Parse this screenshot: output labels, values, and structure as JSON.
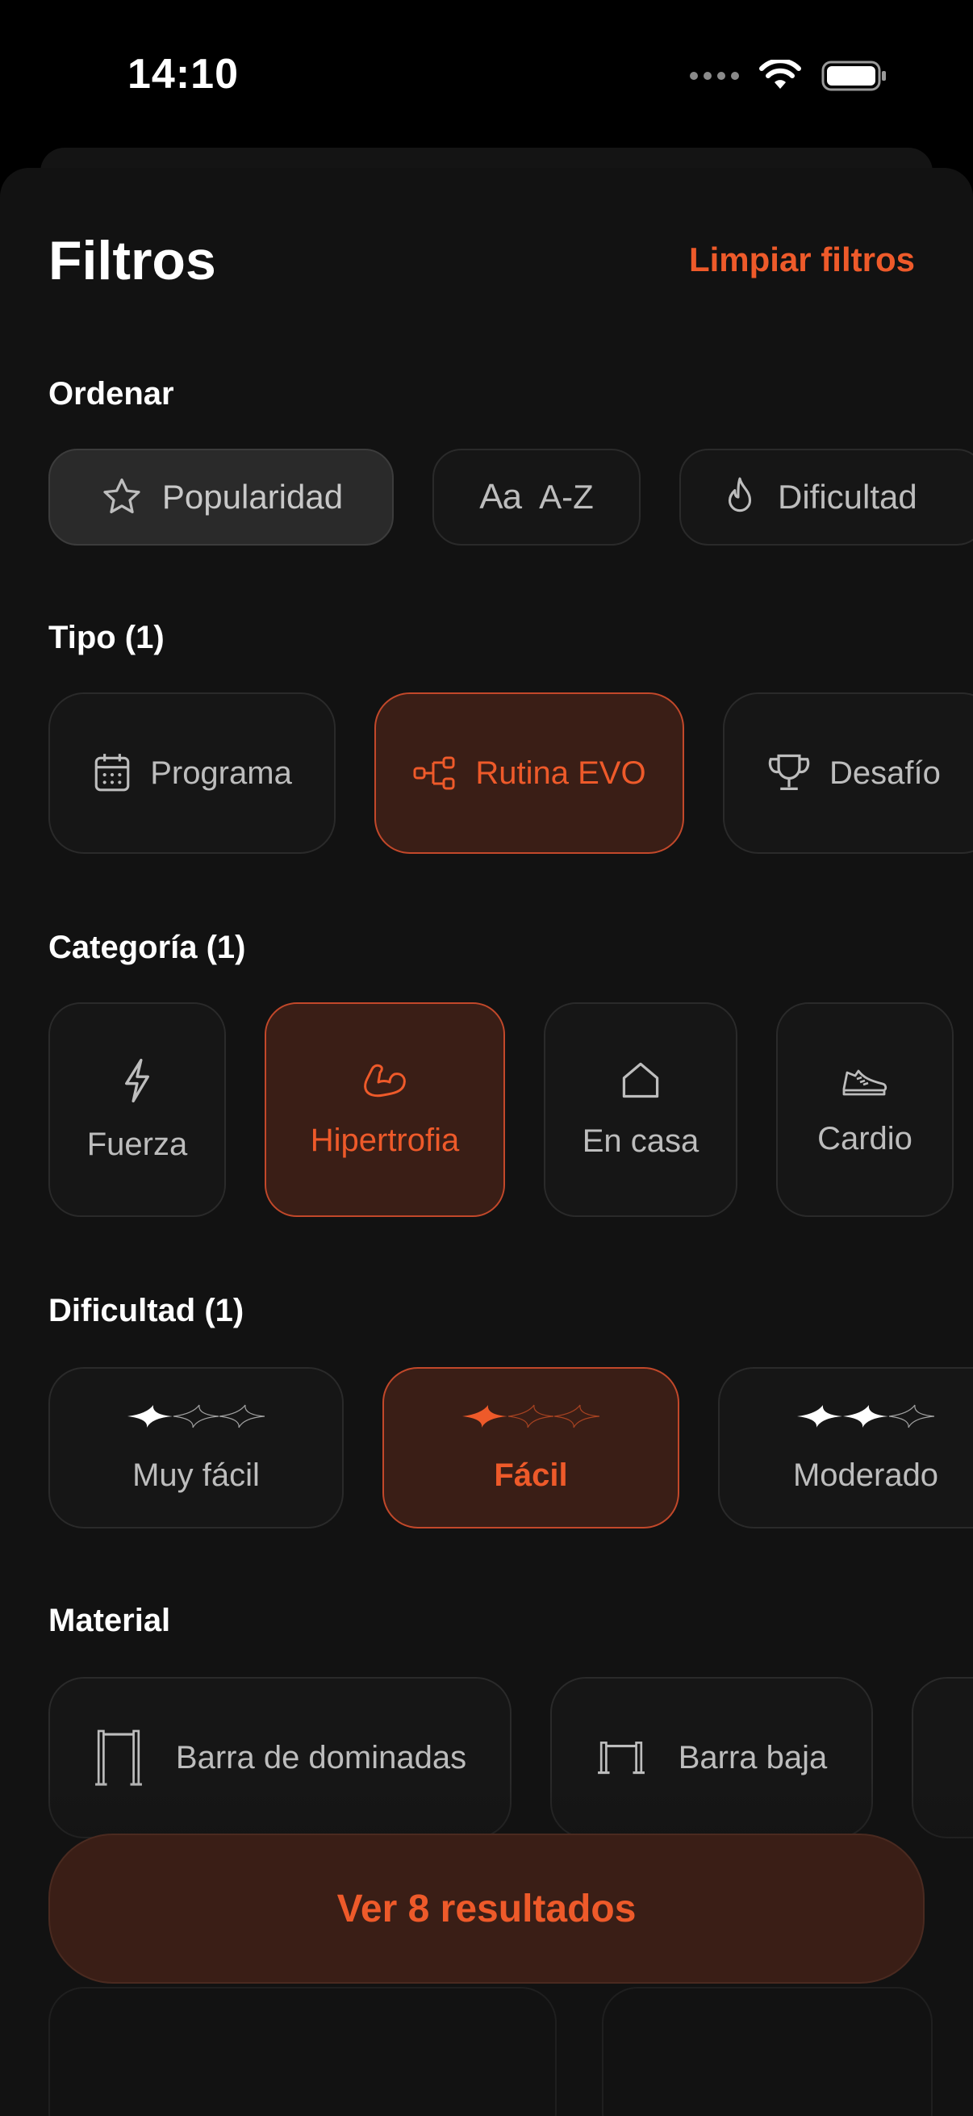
{
  "status": {
    "time": "14:10"
  },
  "header": {
    "title": "Filtros",
    "clear_label": "Limpiar filtros"
  },
  "sort": {
    "label": "Ordenar",
    "options": [
      {
        "label": "Popularidad",
        "icon": "star-icon",
        "selected": true
      },
      {
        "label": "A-Z",
        "icon": "font-aa-icon",
        "selected": false
      },
      {
        "label": "Dificultad",
        "icon": "flame-icon",
        "selected": false
      }
    ]
  },
  "type": {
    "label": "Tipo (1)",
    "options": [
      {
        "label": "Programa",
        "icon": "calendar-icon",
        "selected": false
      },
      {
        "label": "Rutina EVO",
        "icon": "flow-icon",
        "selected": true
      },
      {
        "label": "Desafío",
        "icon": "trophy-icon",
        "selected": false
      }
    ]
  },
  "category": {
    "label": "Categoría (1)",
    "options": [
      {
        "label": "Fuerza",
        "icon": "bolt-icon",
        "selected": false
      },
      {
        "label": "Hipertrofia",
        "icon": "flexed-arm-icon",
        "selected": true
      },
      {
        "label": "En casa",
        "icon": "house-icon",
        "selected": false
      },
      {
        "label": "Cardio",
        "icon": "sneaker-icon",
        "selected": false
      }
    ]
  },
  "difficulty": {
    "label": "Dificultad (1)",
    "options": [
      {
        "label": "Muy fácil",
        "level": 1,
        "max": 3,
        "selected": false
      },
      {
        "label": "Fácil",
        "level": 1,
        "max": 3,
        "selected": true
      },
      {
        "label": "Moderado",
        "level": 2,
        "max": 3,
        "selected": false
      }
    ]
  },
  "material": {
    "label": "Material",
    "options": [
      {
        "label": "Barra de dominadas",
        "icon": "pullup-bar-icon"
      },
      {
        "label": "Barra baja",
        "icon": "low-bar-icon"
      }
    ]
  },
  "cta": {
    "label": "Ver 8 resultados"
  },
  "colors": {
    "accent": "#ee5a2a",
    "accent_bg": "#3a1e16",
    "sheet": "#121212"
  }
}
